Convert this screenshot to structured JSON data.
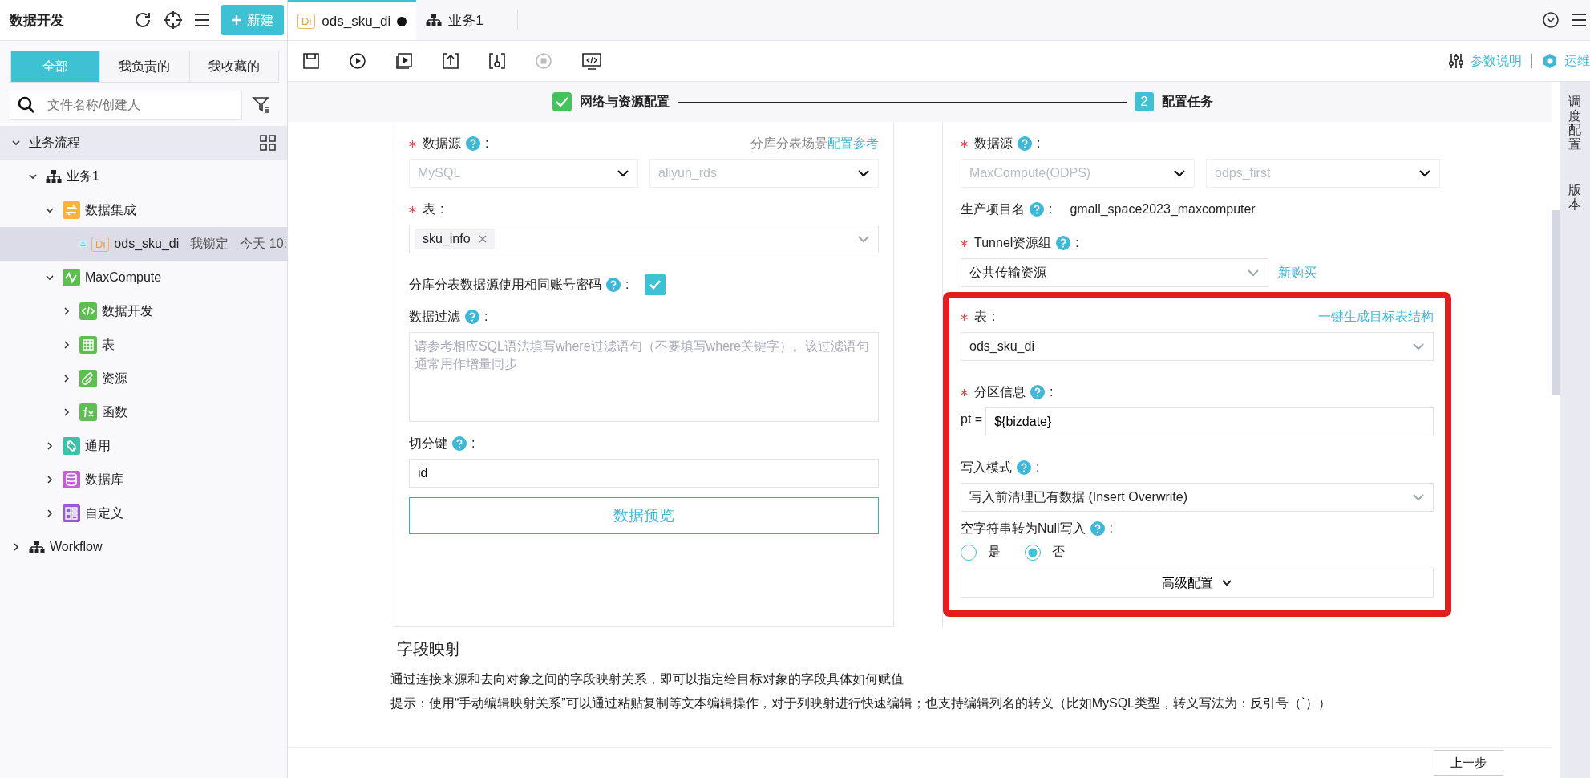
{
  "sidebar": {
    "title": "数据开发",
    "new_button": "新建",
    "filters": [
      {
        "label": "全部",
        "selected": true
      },
      {
        "label": "我负责的",
        "selected": false
      },
      {
        "label": "我收藏的",
        "selected": false
      }
    ],
    "search": {
      "placeholder": "文件名称/创建人"
    },
    "tree": [
      {
        "label": "业务流程",
        "kind": "section",
        "expanded": true,
        "selected": false,
        "children": [
          {
            "label": "业务1",
            "kind": "flow",
            "expanded": true,
            "selected": false,
            "children": [
              {
                "label": "数据集成",
                "kind": "integration",
                "expanded": true,
                "selected": false,
                "children": [
                  {
                    "label": "ods_sku_di",
                    "kind": "di-node",
                    "badge": "Di",
                    "lock": "我锁定",
                    "time": "今天 10:",
                    "selected": true
                  }
                ]
              },
              {
                "label": "MaxCompute",
                "kind": "maxcompute",
                "expanded": true,
                "selected": false,
                "children": [
                  {
                    "label": "数据开发",
                    "kind": "code",
                    "expanded": false,
                    "selected": false
                  },
                  {
                    "label": "表",
                    "kind": "table",
                    "expanded": false,
                    "selected": false
                  },
                  {
                    "label": "资源",
                    "kind": "resource",
                    "expanded": false,
                    "selected": false
                  },
                  {
                    "label": "函数",
                    "kind": "function",
                    "expanded": false,
                    "selected": false
                  }
                ]
              },
              {
                "label": "通用",
                "kind": "general",
                "expanded": false,
                "selected": false
              },
              {
                "label": "数据库",
                "kind": "database",
                "expanded": false,
                "selected": false
              },
              {
                "label": "自定义",
                "kind": "custom",
                "expanded": false,
                "selected": false
              }
            ]
          }
        ]
      },
      {
        "label": "Workflow",
        "kind": "flow",
        "expanded": false,
        "selected": false
      }
    ]
  },
  "tabs": [
    {
      "label": "ods_sku_di",
      "kind": "di",
      "badge": "Di",
      "modified": true,
      "selected": true
    },
    {
      "label": "业务1",
      "kind": "flow",
      "modified": false,
      "selected": false
    }
  ],
  "toolbar": {
    "params_link": "参数说明",
    "ops_link": "运维"
  },
  "steps": [
    {
      "label": "网络与资源配置",
      "done": true
    },
    {
      "label": "配置任务",
      "done": false,
      "number": "2"
    }
  ],
  "source": {
    "datasource_label": {
      "text": "数据源",
      "required": true,
      "help": true,
      "suffix": ":"
    },
    "hint": "分库分表场景",
    "hint_link": "配置参考",
    "type": {
      "value": "MySQL",
      "disabled": true
    },
    "name": {
      "value": "aliyun_rds",
      "disabled": true
    },
    "table_label": {
      "text": "表",
      "required": true,
      "help": false,
      "suffix": ":"
    },
    "table_tags": [
      "sku_info"
    ],
    "same_account_label": {
      "text": "分库分表数据源使用相同账号密码",
      "required": false,
      "help": true,
      "suffix": ":"
    },
    "same_account_checked": true,
    "filter_label": {
      "text": "数据过滤",
      "required": false,
      "help": true,
      "suffix": ":"
    },
    "filter_placeholder": "请参考相应SQL语法填写where过滤语句（不要填写where关键字）。该过滤语句通常用作增量同步",
    "split_label": {
      "text": "切分键",
      "required": false,
      "help": true,
      "suffix": ":"
    },
    "split_value": "id",
    "preview_button": "数据预览"
  },
  "target": {
    "datasource_label": {
      "text": "数据源",
      "required": true,
      "help": true,
      "suffix": ":"
    },
    "type": {
      "value": "MaxCompute(ODPS)",
      "disabled": true
    },
    "name": {
      "value": "odps_first",
      "disabled": true
    },
    "project_label": {
      "text": "生产项目名",
      "required": false,
      "help": true,
      "suffix": ":"
    },
    "project": "gmall_space2023_maxcomputer",
    "tunnel_label": {
      "text": "Tunnel资源组",
      "required": true,
      "help": true,
      "suffix": ":"
    },
    "tunnel": {
      "value": "公共传输资源",
      "disabled": false
    },
    "buy_link": "新购买",
    "table_label": {
      "text": "表",
      "required": true,
      "help": false,
      "suffix": ":"
    },
    "generate_link": "一键生成目标表结构",
    "table": {
      "value": "ods_sku_di",
      "disabled": false
    },
    "partition_label": {
      "text": "分区信息",
      "required": true,
      "help": true,
      "suffix": ":"
    },
    "partition_key": "pt =",
    "partition_value": "${bizdate}",
    "write_mode_label": {
      "text": "写入模式",
      "required": false,
      "help": true,
      "suffix": ":"
    },
    "write_mode": {
      "value": "写入前清理已有数据 (Insert Overwrite)",
      "disabled": false
    },
    "null_label": {
      "text": "空字符串转为Null写入",
      "required": false,
      "help": true,
      "suffix": ":"
    },
    "null_options": [
      {
        "label": "是",
        "selected": false
      },
      {
        "label": "否",
        "selected": true
      }
    ],
    "advanced_button": "高级配置"
  },
  "mapping": {
    "title": "字段映射",
    "description": "通过连接来源和去向对象之间的字段映射关系，即可以指定给目标对象的字段具体如何赋值",
    "hint": "提示：使用“手动编辑映射关系”可以通过粘贴复制等文本编辑操作，对于列映射进行快速编辑；也支持编辑列名的转义（比如MySQL类型，转义写法为：反引号（`））"
  },
  "side_tabs": [
    "调度配置",
    "版本"
  ],
  "footer": {
    "prev_button": "上一步"
  }
}
